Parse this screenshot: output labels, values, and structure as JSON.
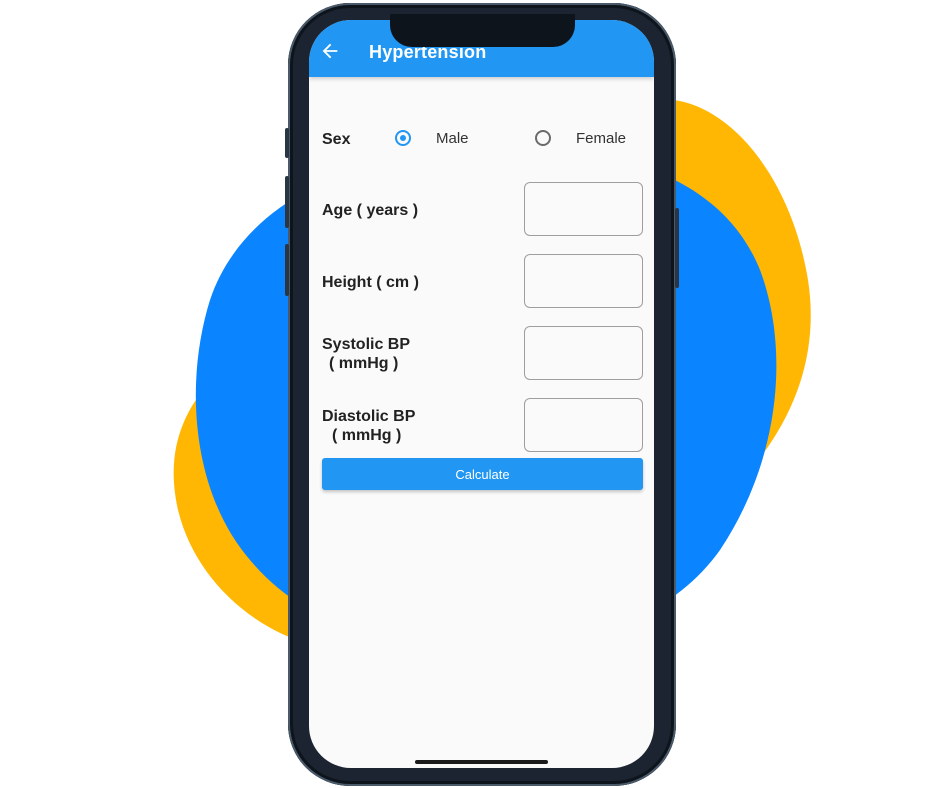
{
  "app_bar": {
    "title": "Hypertension",
    "back_icon": "arrow-left-icon",
    "color": "#2196f3"
  },
  "form": {
    "sex": {
      "label": "Sex",
      "options": [
        {
          "label": "Male",
          "selected": true
        },
        {
          "label": "Female",
          "selected": false
        }
      ]
    },
    "age": {
      "label": "Age ( years )",
      "value": ""
    },
    "height": {
      "label": "Height ( cm )",
      "value": ""
    },
    "systolic": {
      "label_line1": "Systolic BP",
      "label_line2": "( mmHg )",
      "value": ""
    },
    "diastolic": {
      "label_line1": "Diastolic BP",
      "label_line2": "( mmHg )",
      "value": ""
    },
    "calculate_label": "Calculate"
  },
  "colors": {
    "accent": "#2196f3",
    "blob_blue": "#0a84ff",
    "blob_yellow": "#ffb703",
    "phone_frame": "#1b2430"
  }
}
